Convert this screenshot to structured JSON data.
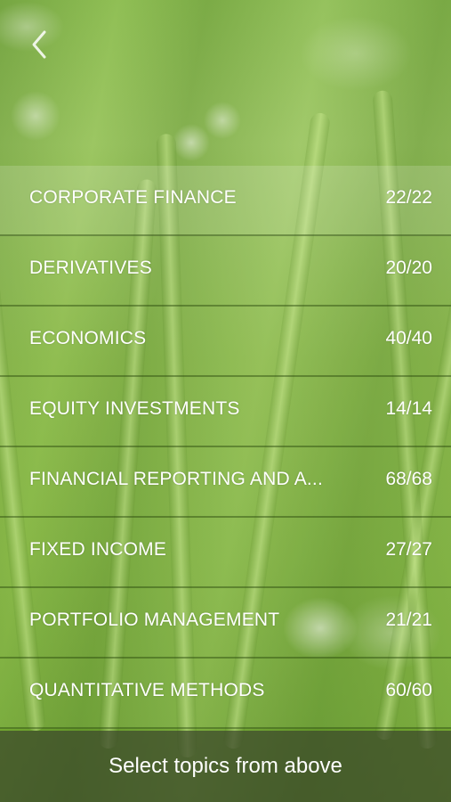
{
  "nav": {
    "back_icon": "chevron-left-icon"
  },
  "topics": [
    {
      "title": "CORPORATE FINANCE",
      "count": "22/22"
    },
    {
      "title": "DERIVATIVES",
      "count": "20/20"
    },
    {
      "title": "ECONOMICS",
      "count": "40/40"
    },
    {
      "title": "EQUITY INVESTMENTS",
      "count": "14/14"
    },
    {
      "title": "FINANCIAL REPORTING AND A...",
      "count": "68/68"
    },
    {
      "title": "FIXED INCOME",
      "count": "27/27"
    },
    {
      "title": "PORTFOLIO MANAGEMENT",
      "count": "21/21"
    },
    {
      "title": "QUANTITATIVE METHODS",
      "count": "60/60"
    }
  ],
  "footer": {
    "label": "Select topics from above"
  },
  "colors": {
    "text": "#ffffff",
    "footer_bg": "#3c462d",
    "background": "#88b944"
  }
}
